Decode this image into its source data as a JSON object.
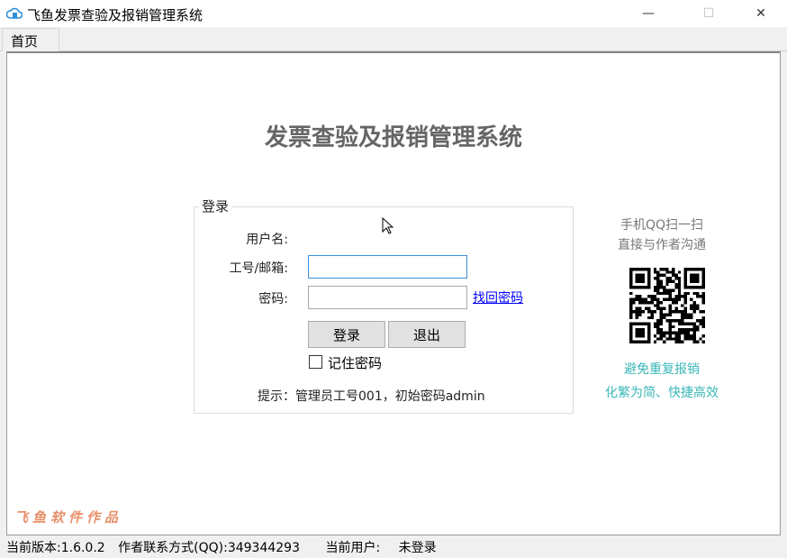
{
  "window": {
    "title": "飞鱼发票查验及报销管理系统",
    "minimize": "—",
    "maximize": "☐",
    "close": "✕"
  },
  "tabs": [
    {
      "label": "首页"
    }
  ],
  "main": {
    "heading": "发票查验及报销管理系统",
    "login": {
      "group_label": "登录",
      "username_label": "用户名:",
      "id_label": "工号/邮箱:",
      "id_value": "",
      "password_label": "密码:",
      "password_value": "",
      "forgot_link": "找回密码",
      "login_button": "登录",
      "exit_button": "退出",
      "remember_label": "记住密码",
      "remember_checked": false,
      "hint": "提示：管理员工号001，初始密码admin"
    },
    "side": {
      "line1": "手机QQ扫一扫",
      "line2": "直接与作者沟通",
      "slogan1": "避免重复报销",
      "slogan2": "化繁为简、快捷高效"
    },
    "brand": "飞鱼软件作品"
  },
  "status": {
    "version": "当前版本:1.6.0.2",
    "contact": "作者联系方式(QQ):349344293",
    "user_label": "当前用户:",
    "user_value": "未登录"
  },
  "colors": {
    "accent": "#3c8fd6",
    "teal": "#3bb7b7",
    "brand": "#e8906a",
    "link": "#0000ff"
  }
}
